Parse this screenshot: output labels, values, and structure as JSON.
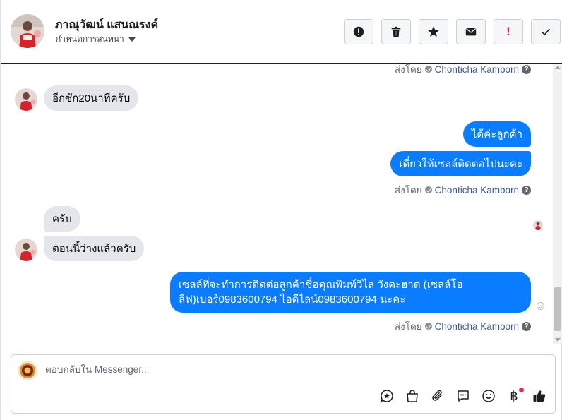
{
  "header": {
    "contact_name": "ภาณุวัฒน์ แสนณรงค์",
    "assign_label": "กำหนดการสนทนา",
    "actions": [
      {
        "name": "spam-icon"
      },
      {
        "name": "trash-icon"
      },
      {
        "name": "star-icon"
      },
      {
        "name": "mail-icon"
      },
      {
        "name": "important-icon",
        "text": "!"
      },
      {
        "name": "check-icon"
      }
    ]
  },
  "thread": {
    "sent_by_prefix": "ส่งโดย",
    "agent_name": "Chonticha Kamborn",
    "help_glyph": "?",
    "messages": {
      "m1": "อีกซัก20นาทีครับ",
      "m2": "ได้ค่ะลูกค้า",
      "m3": "เดี๋ยวให้เซลล์ติดต่อไปนะคะ",
      "m4": "ครับ",
      "m5": "ตอนนี้ว่างแล้วครับ",
      "m6": "เซลล์ที่จะทำการติดต่อลูกค้าชื่อคุณพิมพ์วิไล วังคะฮาต (เซลล์โอลีฟ)เบอร์0983600794 ไอดีไลน์0983600794 นะคะ"
    }
  },
  "composer": {
    "placeholder": "ตอบกลับใน Messenger...",
    "tools": [
      "saved-reply-icon",
      "shop-bag-icon",
      "attachment-icon",
      "chat-bubble-icon",
      "emoji-icon",
      "payment-baht-icon",
      "like-icon"
    ],
    "baht_glyph": "฿"
  },
  "colors": {
    "outgoing": "#0a7cff",
    "incoming": "#e4e6eb",
    "agent_link": "#3e5a8c"
  }
}
